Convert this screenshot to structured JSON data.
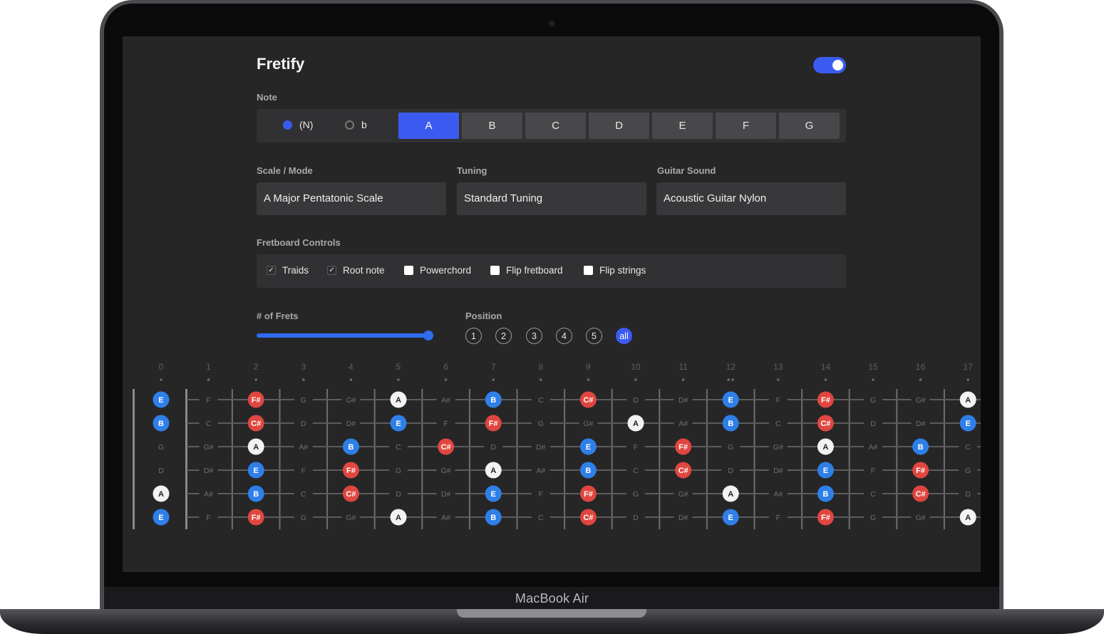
{
  "device": {
    "label": "MacBook Air"
  },
  "app": {
    "title": "Fretify",
    "dark_mode_toggle": true
  },
  "note": {
    "label": "Note",
    "accidentals": [
      {
        "label": "(N)",
        "selected": true
      },
      {
        "label": "b",
        "selected": false
      }
    ],
    "buttons": [
      "A",
      "B",
      "C",
      "D",
      "E",
      "F",
      "G"
    ],
    "active": "A"
  },
  "scale": {
    "label": "Scale / Mode",
    "value": "A Major Pentatonic Scale"
  },
  "tuning": {
    "label": "Tuning",
    "value": "Standard Tuning"
  },
  "sound": {
    "label": "Guitar Sound",
    "value": "Acoustic Guitar Nylon"
  },
  "controls": {
    "label": "Fretboard Controls",
    "items": [
      {
        "label": "Traids",
        "checked": true
      },
      {
        "label": "Root note",
        "checked": true
      },
      {
        "label": "Powerchord",
        "checked": false
      },
      {
        "label": "Flip fretboard",
        "checked": false
      },
      {
        "label": "Flip strings",
        "checked": false
      }
    ]
  },
  "frets": {
    "label": "# of Frets",
    "value_fraction": 1.0
  },
  "position": {
    "label": "Position",
    "options": [
      "1",
      "2",
      "3",
      "4",
      "5",
      "all"
    ],
    "active": "all"
  },
  "colors": {
    "accent": "#3b5bf0",
    "root": "#f2f2f2",
    "red": "#e0463f",
    "blue": "#2f7fe8"
  },
  "fretboard": {
    "fret_numbers": [
      "0",
      "1",
      "2",
      "3",
      "4",
      "5",
      "6",
      "7",
      "8",
      "9",
      "10",
      "11",
      "12",
      "13",
      "14",
      "15",
      "16",
      "17"
    ],
    "strings": [
      [
        {
          "n": "E",
          "m": "blue"
        },
        {
          "n": "F"
        },
        {
          "n": "F#",
          "m": "red"
        },
        {
          "n": "G"
        },
        {
          "n": "G#"
        },
        {
          "n": "A",
          "m": "white"
        },
        {
          "n": "A#"
        },
        {
          "n": "B",
          "m": "blue"
        },
        {
          "n": "C"
        },
        {
          "n": "C#",
          "m": "red"
        },
        {
          "n": "D"
        },
        {
          "n": "D#"
        },
        {
          "n": "E",
          "m": "blue"
        },
        {
          "n": "F"
        },
        {
          "n": "F#",
          "m": "red"
        },
        {
          "n": "G"
        },
        {
          "n": "G#"
        },
        {
          "n": "A",
          "m": "white"
        }
      ],
      [
        {
          "n": "B",
          "m": "blue"
        },
        {
          "n": "C"
        },
        {
          "n": "C#",
          "m": "red"
        },
        {
          "n": "D"
        },
        {
          "n": "D#"
        },
        {
          "n": "E",
          "m": "blue"
        },
        {
          "n": "F"
        },
        {
          "n": "F#",
          "m": "red"
        },
        {
          "n": "G"
        },
        {
          "n": "G#"
        },
        {
          "n": "A",
          "m": "white"
        },
        {
          "n": "A#"
        },
        {
          "n": "B",
          "m": "blue"
        },
        {
          "n": "C"
        },
        {
          "n": "C#",
          "m": "red"
        },
        {
          "n": "D"
        },
        {
          "n": "D#"
        },
        {
          "n": "E",
          "m": "blue"
        }
      ],
      [
        {
          "n": "G"
        },
        {
          "n": "G#"
        },
        {
          "n": "A",
          "m": "white"
        },
        {
          "n": "A#"
        },
        {
          "n": "B",
          "m": "blue"
        },
        {
          "n": "C"
        },
        {
          "n": "C#",
          "m": "red"
        },
        {
          "n": "D"
        },
        {
          "n": "D#"
        },
        {
          "n": "E",
          "m": "blue"
        },
        {
          "n": "F"
        },
        {
          "n": "F#",
          "m": "red"
        },
        {
          "n": "G"
        },
        {
          "n": "G#"
        },
        {
          "n": "A",
          "m": "white"
        },
        {
          "n": "A#"
        },
        {
          "n": "B",
          "m": "blue"
        },
        {
          "n": "C"
        }
      ],
      [
        {
          "n": "D"
        },
        {
          "n": "D#"
        },
        {
          "n": "E",
          "m": "blue"
        },
        {
          "n": "F"
        },
        {
          "n": "F#",
          "m": "red"
        },
        {
          "n": "G"
        },
        {
          "n": "G#"
        },
        {
          "n": "A",
          "m": "white"
        },
        {
          "n": "A#"
        },
        {
          "n": "B",
          "m": "blue"
        },
        {
          "n": "C"
        },
        {
          "n": "C#",
          "m": "red"
        },
        {
          "n": "D"
        },
        {
          "n": "D#"
        },
        {
          "n": "E",
          "m": "blue"
        },
        {
          "n": "F"
        },
        {
          "n": "F#",
          "m": "red"
        },
        {
          "n": "G"
        }
      ],
      [
        {
          "n": "A",
          "m": "white"
        },
        {
          "n": "A#"
        },
        {
          "n": "B",
          "m": "blue"
        },
        {
          "n": "C"
        },
        {
          "n": "C#",
          "m": "red"
        },
        {
          "n": "D"
        },
        {
          "n": "D#"
        },
        {
          "n": "E",
          "m": "blue"
        },
        {
          "n": "F"
        },
        {
          "n": "F#",
          "m": "red"
        },
        {
          "n": "G"
        },
        {
          "n": "G#"
        },
        {
          "n": "A",
          "m": "white"
        },
        {
          "n": "A#"
        },
        {
          "n": "B",
          "m": "blue"
        },
        {
          "n": "C"
        },
        {
          "n": "C#",
          "m": "red"
        },
        {
          "n": "D"
        }
      ],
      [
        {
          "n": "E",
          "m": "blue"
        },
        {
          "n": "F"
        },
        {
          "n": "F#",
          "m": "red"
        },
        {
          "n": "G"
        },
        {
          "n": "G#"
        },
        {
          "n": "A",
          "m": "white"
        },
        {
          "n": "A#"
        },
        {
          "n": "B",
          "m": "blue"
        },
        {
          "n": "C"
        },
        {
          "n": "C#",
          "m": "red"
        },
        {
          "n": "D"
        },
        {
          "n": "D#"
        },
        {
          "n": "E",
          "m": "blue"
        },
        {
          "n": "F"
        },
        {
          "n": "F#",
          "m": "red"
        },
        {
          "n": "G"
        },
        {
          "n": "G#"
        },
        {
          "n": "A",
          "m": "white"
        }
      ]
    ]
  }
}
